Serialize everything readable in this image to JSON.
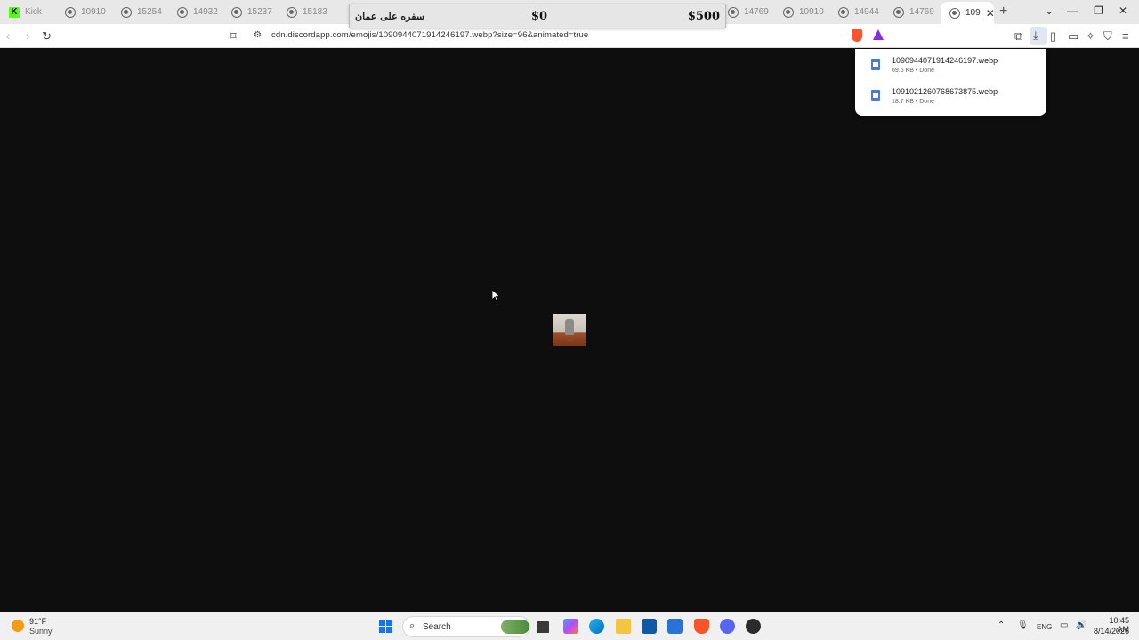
{
  "tabs": [
    {
      "label": "Kick",
      "icon": "kick-icon"
    },
    {
      "label": "10910",
      "icon": "globe-icon"
    },
    {
      "label": "15254",
      "icon": "globe-icon"
    },
    {
      "label": "14932",
      "icon": "globe-icon"
    },
    {
      "label": "15237",
      "icon": "globe-icon"
    },
    {
      "label": "15183",
      "icon": "globe-icon"
    },
    {
      "label": "14769",
      "icon": "globe-icon"
    },
    {
      "label": "10910",
      "icon": "globe-icon"
    },
    {
      "label": "14944",
      "icon": "globe-icon"
    },
    {
      "label": "14769",
      "icon": "globe-icon"
    },
    {
      "label": "109",
      "icon": "globe-icon",
      "active": true
    }
  ],
  "overlay": {
    "title": "سفره على عمان",
    "left_amount": "$0",
    "right_amount": "$500"
  },
  "address_bar": {
    "url": "cdn.discordapp.com/emojis/1090944071914246197.webp?size=96&animated=true"
  },
  "downloads": [
    {
      "filename": "1090944071914246197.webp",
      "meta": "69.6 KB • Done"
    },
    {
      "filename": "1091021260768673875.webp",
      "meta": "18.7 KB • Done"
    }
  ],
  "taskbar": {
    "weather_temp": "91°F",
    "weather_condition": "Sunny",
    "search_label": "Search",
    "language": "ENG",
    "time": "10:45 AM",
    "date": "8/14/2026"
  },
  "colors": {
    "page_background": "#0e0e0e",
    "brave_shield": "#fb542b",
    "kick_green": "#53fc18",
    "windows_blue": "#1a73e8"
  }
}
